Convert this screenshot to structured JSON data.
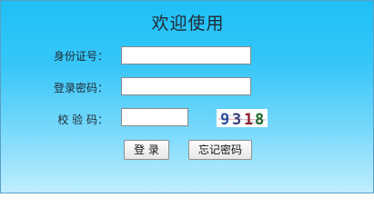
{
  "form": {
    "title": "欢迎使用",
    "id_label": "身份证号：",
    "id_value": "",
    "password_label": "登录密码：",
    "password_value": "",
    "captcha_label": "校 验 码：",
    "captcha_value": "",
    "captcha_image_text": "9318",
    "login_button": "登 录",
    "forgot_button": "忘记密码"
  }
}
